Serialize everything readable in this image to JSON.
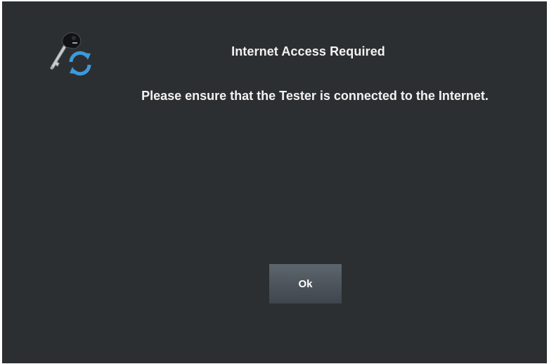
{
  "dialog": {
    "title": "Internet Access Required",
    "message": "Please ensure that the Tester is connected to the Internet.",
    "ok_label": "Ok",
    "icon": "key-sync-icon"
  },
  "colors": {
    "background": "#2c2f31",
    "text": "#f2f2f2",
    "button": "#4f575e",
    "sync_blue": "#3d9ad9"
  }
}
